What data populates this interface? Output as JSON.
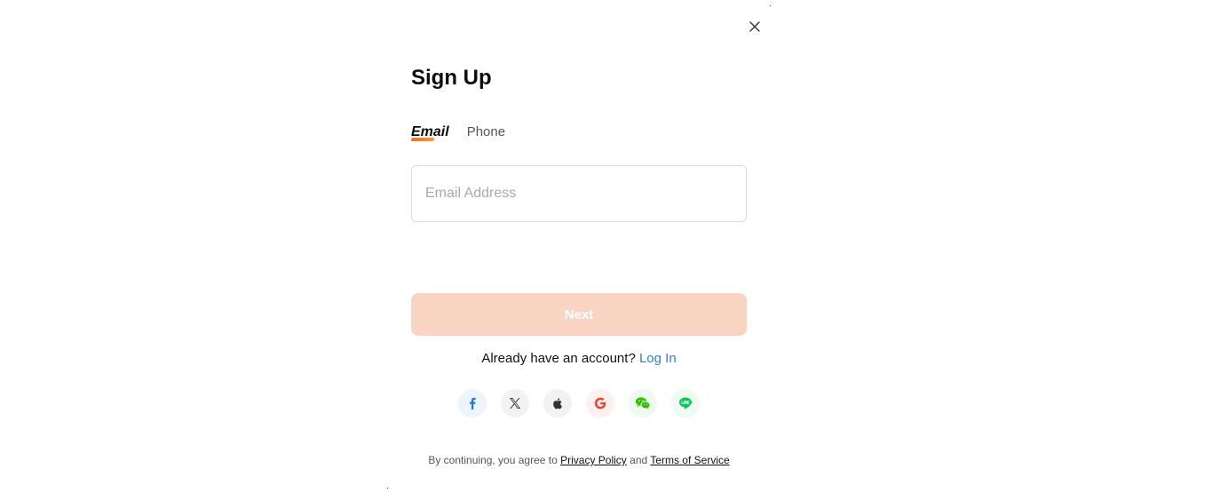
{
  "dialog": {
    "title": "Sign Up",
    "close_icon": "close-icon"
  },
  "tabs": [
    {
      "label": "Email",
      "active": true
    },
    {
      "label": "Phone",
      "active": false
    }
  ],
  "email_input": {
    "placeholder": "Email Address",
    "value": ""
  },
  "next_button": {
    "label": "Next",
    "disabled": true,
    "color": "#f9d4c3"
  },
  "login_prompt": {
    "text": "Already have an account?",
    "link": "Log In",
    "link_color": "#2f7ee0"
  },
  "social_logins": [
    {
      "icon": "facebook-icon",
      "color": "#1877f2"
    },
    {
      "icon": "x-icon",
      "color": "#333333"
    },
    {
      "icon": "apple-icon",
      "color": "#333333"
    },
    {
      "icon": "google-icon",
      "color": "#ea4335"
    },
    {
      "icon": "wechat-icon",
      "color": "#2dc100"
    },
    {
      "icon": "line-icon",
      "color": "#06c755"
    }
  ],
  "legal": {
    "prefix": "By continuing, you agree to",
    "privacy": "Privacy Policy",
    "and": "and",
    "terms": "Terms of Service"
  },
  "accent_color": "#ff6a1a"
}
